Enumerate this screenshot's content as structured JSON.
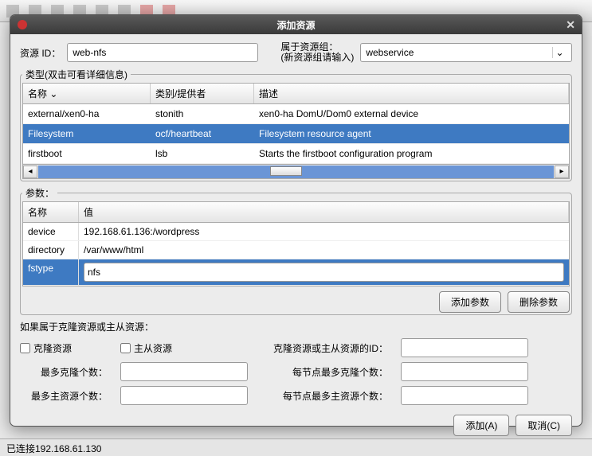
{
  "toolbar_icons": [
    "doc",
    "save",
    "undo",
    "redo",
    "left",
    "right",
    "stop",
    "record"
  ],
  "dialog": {
    "title": "添加资源"
  },
  "form": {
    "resource_id_label": "资源 ID：",
    "resource_id_value": "web-nfs",
    "group_label1": "属于资源组：",
    "group_label2": "(新资源组请输入)",
    "group_value": "webservice"
  },
  "type_section": {
    "legend": "类型(双击可看详细信息)",
    "headers": {
      "name": "名称",
      "provider": "类别/提供者",
      "desc": "描述"
    },
    "rows": [
      {
        "name": "external/xen0-ha",
        "provider": "stonith",
        "desc": "xen0-ha DomU/Dom0 external device"
      },
      {
        "name": "Filesystem",
        "provider": "ocf/heartbeat",
        "desc": "Filesystem resource agent",
        "selected": true
      },
      {
        "name": "firstboot",
        "provider": "lsb",
        "desc": "Starts the firstboot configuration program"
      }
    ]
  },
  "params": {
    "legend": "参数：",
    "headers": {
      "name": "名称",
      "value": "值"
    },
    "rows": [
      {
        "name": "device",
        "value": "192.168.61.136:/wordpress"
      },
      {
        "name": "directory",
        "value": "/var/www/html"
      },
      {
        "name": "fstype",
        "value": "nfs",
        "selected": true,
        "editing": true
      }
    ],
    "add_btn": "添加参数",
    "del_btn": "删除参数"
  },
  "clone": {
    "legend": "如果属于克隆资源或主从资源：",
    "clone_chk": "克隆资源",
    "ms_chk": "主从资源",
    "id_label": "克隆资源或主从资源的ID：",
    "max_clone": "最多克隆个数：",
    "max_clone_node": "每节点最多克隆个数：",
    "max_ms": "最多主资源个数：",
    "max_ms_node": "每节点最多主资源个数："
  },
  "buttons": {
    "ok": "添加(A)",
    "cancel": "取消(C)"
  },
  "status": "已连接192.168.61.130"
}
